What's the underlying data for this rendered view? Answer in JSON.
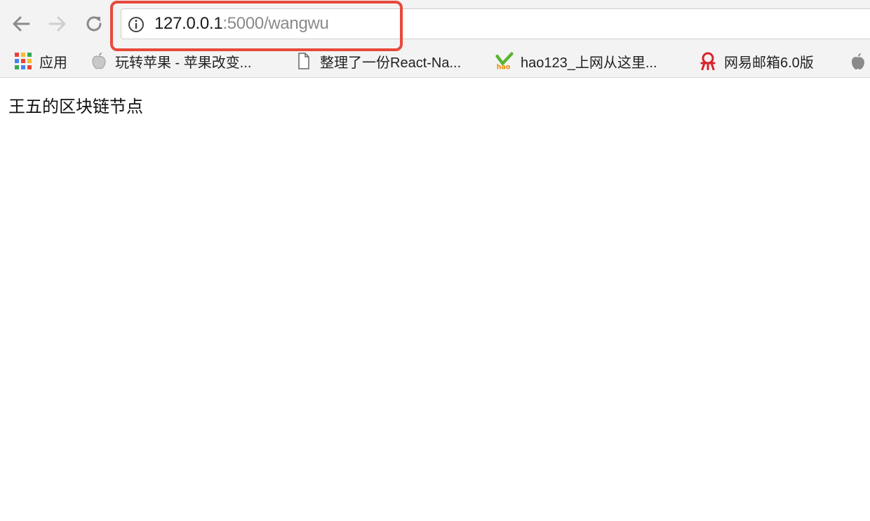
{
  "address_bar": {
    "url_host": "127.0.0.1",
    "url_path": ":5000/wangwu"
  },
  "icons": {
    "back": "back-arrow-icon",
    "forward": "forward-arrow-icon",
    "reload": "reload-icon",
    "info": "info-icon",
    "apps": "apps-grid-icon",
    "apple": "apple-icon",
    "file": "file-icon",
    "hao123": "hao123-icon",
    "netease": "netease-mail-icon"
  },
  "bookmarks": [
    {
      "label": "应用"
    },
    {
      "label": "玩转苹果 - 苹果改变..."
    },
    {
      "label": "整理了一份React-Na..."
    },
    {
      "label": "hao123_上网从这里..."
    },
    {
      "label": "网易邮箱6.0版"
    }
  ],
  "page": {
    "body_text": "王五的区块链节点"
  },
  "colors": {
    "highlight": "#e8493b",
    "toolbar_bg": "#f3f3f3"
  }
}
